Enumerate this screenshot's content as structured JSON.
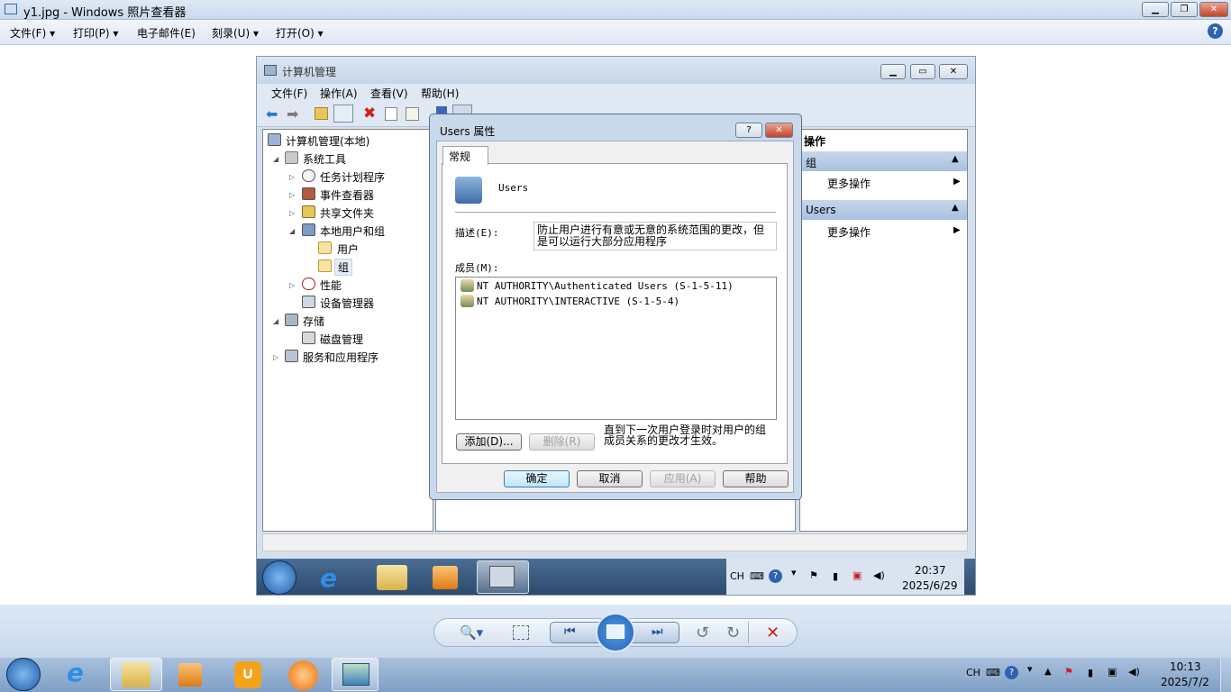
{
  "viewer": {
    "title": "y1.jpg - Windows 照片查看器",
    "menu": {
      "file": "文件(F)",
      "print": "打印(P)",
      "email": "电子邮件(E)",
      "burn": "刻录(U)",
      "open": "打开(O)"
    },
    "help_glyph": "?"
  },
  "mmc": {
    "title": "计算机管理",
    "menu": {
      "file": "文件(F)",
      "action": "操作(A)",
      "view": "查看(V)",
      "help": "帮助(H)"
    },
    "tree": {
      "root": "计算机管理(本地)",
      "system_tools": "系统工具",
      "task_scheduler": "任务计划程序",
      "event_viewer": "事件查看器",
      "shared_folders": "共享文件夹",
      "local_users_groups": "本地用户和组",
      "users": "用户",
      "groups": "组",
      "performance": "性能",
      "device_manager": "设备管理器",
      "storage": "存储",
      "disk_management": "磁盘管理",
      "services_apps": "服务和应用程序"
    },
    "actions": {
      "header": "操作",
      "section1": "组",
      "more1": "更多操作",
      "section2": "Users",
      "more2": "更多操作"
    }
  },
  "dialog": {
    "title": "Users 属性",
    "help_glyph": "?",
    "tab_general": "常规",
    "group_name": "Users",
    "description_label": "描述(E):",
    "description_value": "防止用户进行有意或无意的系统范围的更改，但是可以运行大部分应用程序",
    "members_label": "成员(M):",
    "members": [
      "NT AUTHORITY\\Authenticated Users (S-1-5-11)",
      "NT AUTHORITY\\INTERACTIVE (S-1-5-4)"
    ],
    "add_button": "添加(D)...",
    "remove_button": "删除(R)",
    "note": "直到下一次用户登录时对用户的组成员关系的更改才生效。",
    "ok_button": "确定",
    "cancel_button": "取消",
    "apply_button": "应用(A)",
    "help_button": "帮助"
  },
  "inner_taskbar": {
    "lang": "CH",
    "time": "20:37",
    "date": "2025/6/29"
  },
  "host_taskbar": {
    "lang": "CH",
    "time": "10:13",
    "date": "2025/7/2"
  }
}
